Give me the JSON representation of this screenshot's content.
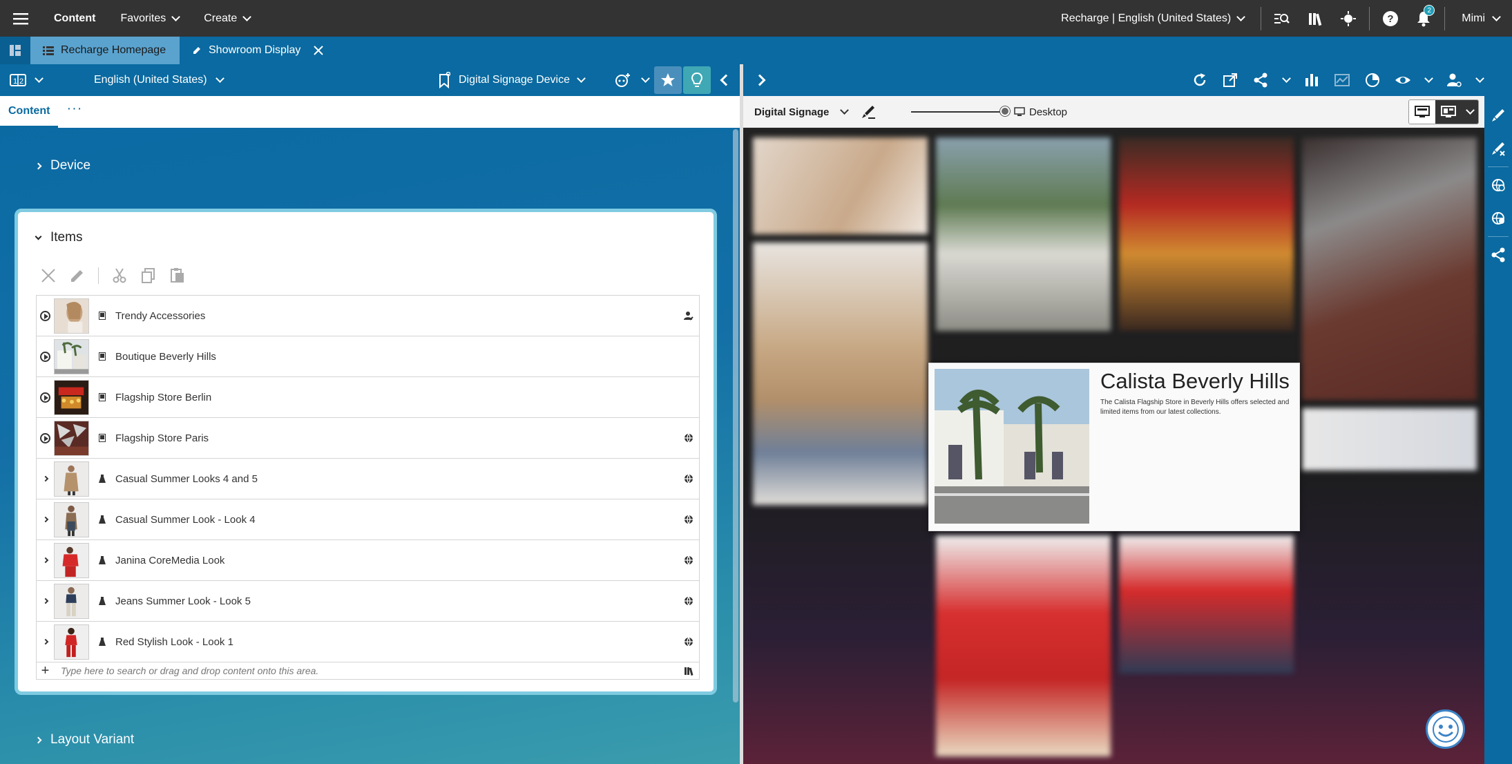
{
  "topbar": {
    "menu": [
      {
        "label": "Content"
      },
      {
        "label": "Favorites"
      },
      {
        "label": "Create"
      }
    ],
    "site": "Recharge | English (United States)",
    "notification_count": "2",
    "user": "Mimi"
  },
  "tabs": [
    {
      "label": "Recharge Homepage"
    },
    {
      "label": "Showroom Display"
    }
  ],
  "left_toolbar": {
    "locale": "English (United States)",
    "device": "Digital Signage Device"
  },
  "form": {
    "tab_label": "Content",
    "more": "···",
    "section_device": "Device",
    "section_items": "Items",
    "section_layout": "Layout Variant",
    "items": [
      {
        "label": "Trendy Accessories",
        "expander": "play",
        "type": "display",
        "right": "user"
      },
      {
        "label": "Boutique Beverly Hills",
        "expander": "play",
        "type": "display",
        "right": ""
      },
      {
        "label": "Flagship Store Berlin",
        "expander": "play",
        "type": "display",
        "right": ""
      },
      {
        "label": "Flagship Store Paris",
        "expander": "play",
        "type": "display",
        "right": "globe"
      },
      {
        "label": "Casual Summer Looks 4 and 5",
        "expander": "arrow",
        "type": "look",
        "right": "globe"
      },
      {
        "label": "Casual Summer Look - Look 4",
        "expander": "arrow",
        "type": "look",
        "right": "globe"
      },
      {
        "label": "Janina CoreMedia Look",
        "expander": "arrow",
        "type": "look",
        "right": "globe"
      },
      {
        "label": "Jeans Summer Look - Look 5",
        "expander": "arrow",
        "type": "look",
        "right": "globe"
      },
      {
        "label": "Red Stylish Look - Look 1",
        "expander": "arrow",
        "type": "look",
        "right": "globe"
      }
    ],
    "search_placeholder": "Type here to search or drag and drop content onto this area."
  },
  "preview": {
    "channel": "Digital Signage",
    "mode": "Desktop",
    "popup_title": "Calista Beverly Hills",
    "popup_desc": "The Calista Flagship Store in Beverly Hills offers selected and limited items from our latest collections."
  },
  "colors": {
    "primary": "#0a6aa1",
    "topbar": "#333333",
    "accent": "#3fa8b4",
    "card_border": "#7fcbe1"
  }
}
